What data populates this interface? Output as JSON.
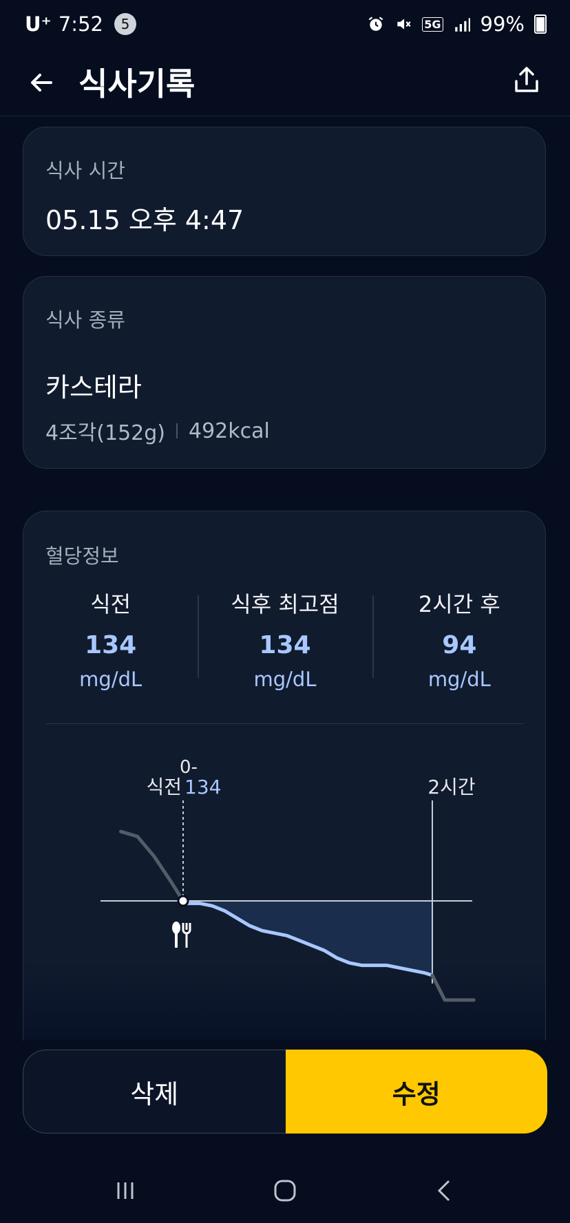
{
  "status_bar": {
    "carrier": "U⁺",
    "time": "7:52",
    "notification_count": "5",
    "network": "5G",
    "battery": "99%"
  },
  "app_bar": {
    "title": "식사기록",
    "back_icon": "arrow-left-icon",
    "share_icon": "share-icon"
  },
  "meal_time": {
    "label": "식사 시간",
    "value": "05.15 오후 4:47"
  },
  "meal_type": {
    "label": "식사 종류",
    "food_name": "카스테라",
    "portion": "4조각(152g)",
    "calories": "492kcal"
  },
  "glucose": {
    "label": "혈당정보",
    "stats": [
      {
        "label": "식전",
        "value": "134",
        "unit": "mg/dL"
      },
      {
        "label": "식후 최고점",
        "value": "134",
        "unit": "mg/dL"
      },
      {
        "label": "2시간 후",
        "value": "94",
        "unit": "mg/dL"
      }
    ],
    "chart": {
      "marker_top": "0-",
      "marker_label": "식전",
      "marker_value": "134",
      "end_label": "2시간",
      "meal_icon": "fork-knife-icon"
    }
  },
  "chart_data": {
    "type": "area",
    "title": "",
    "xlabel": "",
    "ylabel": "",
    "x_minutes": [
      -30,
      -22,
      -14,
      -6,
      0,
      2,
      8,
      14,
      20,
      26,
      32,
      38,
      44,
      50,
      56,
      62,
      68,
      74,
      80,
      86,
      92,
      98,
      104,
      110,
      116,
      120,
      126,
      134,
      140
    ],
    "values": [
      162,
      160,
      152,
      142,
      134,
      133,
      133,
      132,
      130,
      127,
      124,
      122,
      121,
      120,
      118,
      116,
      114,
      111,
      109,
      108,
      108,
      108,
      107,
      106,
      105,
      104,
      94,
      94,
      94
    ],
    "baseline": 134,
    "meal_x_minutes": 0,
    "end_x_minutes": 120,
    "markers": [
      "식전 134",
      "2시간"
    ],
    "colors": {
      "line": "#a8c8ff",
      "fill": "#1a2d4d",
      "outside": "#555c68",
      "baseline": "#c8cdd6"
    }
  },
  "actions": {
    "delete_label": "삭제",
    "edit_label": "수정",
    "edit_color": "#ffc800"
  },
  "nav": {
    "recents_icon": "recents-icon",
    "home_icon": "home-icon",
    "back_icon": "back-chevron-icon"
  }
}
